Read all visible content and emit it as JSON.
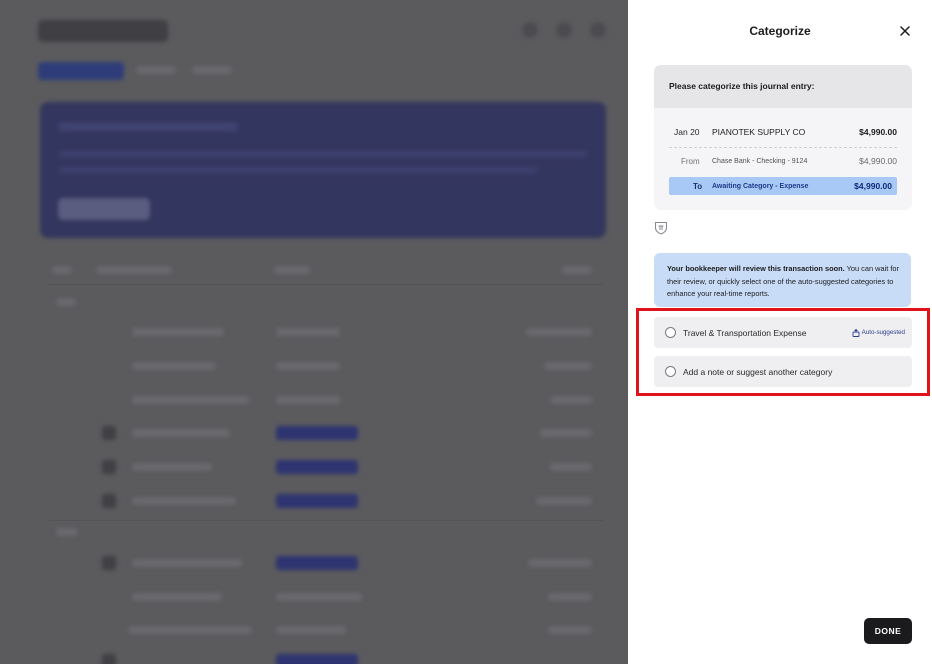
{
  "panel": {
    "title": "Categorize",
    "close_icon": "close-icon"
  },
  "entry": {
    "heading": "Please categorize this journal entry:",
    "date": "Jan 20",
    "vendor": "PIANOTEK SUPPLY CO",
    "amount": "$4,990.00",
    "from_label": "From",
    "from_account": "Chase Bank - Checking - 9124",
    "from_amount": "$4,990.00",
    "to_label": "To",
    "to_account": "Awaiting Category - Expense",
    "to_amount": "$4,990.00"
  },
  "notice": {
    "bold": "Your bookkeeper will review this transaction soon.",
    "text": " You can wait for their review, or quickly select one of the auto-suggested categories to enhance your real-time reports."
  },
  "options": [
    {
      "label": "Travel & Transportation Expense",
      "badge": "Auto-suggested",
      "selected": false
    },
    {
      "label": "Add a note or suggest another category",
      "selected": false
    }
  ],
  "footer": {
    "done_label": "DONE"
  },
  "colors": {
    "highlight": "#e0121c",
    "to_row": "#a8c9f5",
    "notice_bg": "#c9dcf7",
    "done_bg": "#1b1b1e"
  }
}
